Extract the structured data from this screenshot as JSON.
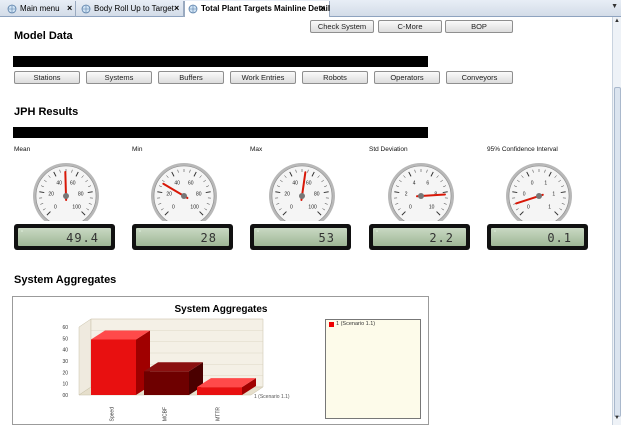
{
  "tabs": [
    {
      "label": "Main menu",
      "active": false
    },
    {
      "label": "Body Roll Up to Target",
      "active": false
    },
    {
      "label": "Total Plant Targets Mainline Detail",
      "active": true
    }
  ],
  "top_buttons": [
    "Check System",
    "C-More",
    "BOP"
  ],
  "model_data": {
    "title": "Model Data",
    "buttons": [
      "Stations",
      "Systems",
      "Buffers",
      "Work Entries",
      "Robots",
      "Operators",
      "Conveyors"
    ]
  },
  "jph": {
    "title": "JPH Results",
    "gauges": [
      {
        "label": "Mean",
        "value": "49.4",
        "num": 49.4,
        "min": 0,
        "max": 100,
        "ticks": [
          "0",
          "20",
          "40",
          "60",
          "80",
          "100"
        ]
      },
      {
        "label": "Min",
        "value": "28",
        "num": 28,
        "min": 0,
        "max": 100,
        "ticks": [
          "0",
          "20",
          "40",
          "60",
          "80",
          "100"
        ]
      },
      {
        "label": "Max",
        "value": "53",
        "num": 53,
        "min": 0,
        "max": 100,
        "ticks": [
          "0",
          "20",
          "40",
          "60",
          "80",
          "100"
        ]
      },
      {
        "label": "Std Deviation",
        "value": "2.2",
        "num": 8.2,
        "min": 0,
        "max": 10,
        "ticks": [
          "0",
          "2",
          "4",
          "6",
          "8",
          "10"
        ]
      },
      {
        "label": "95% Confidence Interval",
        "value": "0.1",
        "num": 0.1,
        "min": 0,
        "max": 1,
        "ticks": [
          "0",
          "0",
          "0",
          "1",
          "1",
          "1"
        ]
      }
    ]
  },
  "aggregates": {
    "section_title": "System Aggregates",
    "chart_title": "System Aggregates",
    "legend": [
      "1 (Scenario 1.1)"
    ]
  },
  "chart_data": {
    "type": "bar",
    "title": "System Aggregates",
    "categories": [
      "Speed",
      "MCBF",
      "MTTR"
    ],
    "series": [
      {
        "name": "1 (Scenario 1.1)",
        "values": [
          49,
          21,
          7
        ]
      }
    ],
    "y_ticks": [
      "00",
      "10",
      "20",
      "30",
      "40",
      "50",
      "60"
    ],
    "ylim": [
      0,
      60
    ],
    "depth_label": "1 (Scenario 1.1)",
    "colors": [
      "#e81010",
      "#6e0000",
      "#e81010"
    ]
  },
  "colors": {
    "accent_red": "#e81010",
    "dark_red": "#6e0000",
    "lcd_green": "#b3c8ab"
  }
}
